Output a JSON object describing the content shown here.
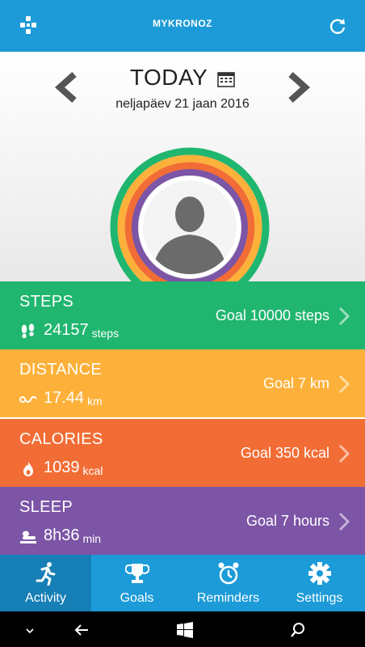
{
  "appbar": {
    "brand": "MYKRONOZ",
    "left_icon": "device-icon",
    "right_icon": "refresh-icon"
  },
  "date": {
    "title": "TODAY",
    "subtitle": "neljapäev 21 jaan 2016"
  },
  "profile": {
    "ring_colors": [
      "#20b66f",
      "#fdb13a",
      "#f26d35",
      "#7c55a6"
    ]
  },
  "metrics": {
    "steps": {
      "label": "STEPS",
      "value": "24157",
      "unit": "steps",
      "goal": "Goal 10000 steps",
      "color": "#20b66f"
    },
    "distance": {
      "label": "DISTANCE",
      "value": "17.44",
      "unit": "km",
      "goal": "Goal 7 km",
      "color": "#fdb13a"
    },
    "calories": {
      "label": "CALORIES",
      "value": "1039",
      "unit": "kcal",
      "goal": "Goal 350 kcal",
      "color": "#f26d35"
    },
    "sleep": {
      "label": "SLEEP",
      "value": "8h36",
      "unit": "min",
      "goal": "Goal 7 hours",
      "color": "#7c55a6"
    }
  },
  "tabs": [
    {
      "label": "Activity",
      "icon": "runner-icon",
      "active": true
    },
    {
      "label": "Goals",
      "icon": "trophy-icon",
      "active": false
    },
    {
      "label": "Reminders",
      "icon": "alarm-clock-icon",
      "active": false
    },
    {
      "label": "Settings",
      "icon": "gear-icon",
      "active": false
    }
  ],
  "system_nav": [
    "chevron-down-icon",
    "back-icon",
    "windows-icon",
    "search-icon"
  ]
}
